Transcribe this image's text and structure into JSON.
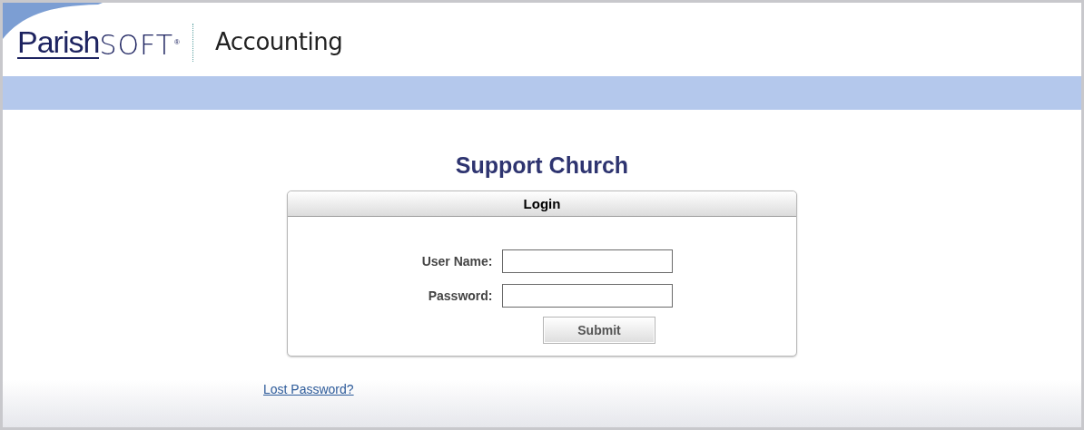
{
  "logo": {
    "brand_1": "Parish",
    "brand_2": "SOFT",
    "mark": "®"
  },
  "product": "Accounting",
  "page_title": "Support Church",
  "login": {
    "title": "Login",
    "fields": [
      {
        "label": "User Name:"
      },
      {
        "label": "Password:"
      }
    ],
    "submit": "Submit"
  },
  "lost_password_link": "Lost Password?"
}
